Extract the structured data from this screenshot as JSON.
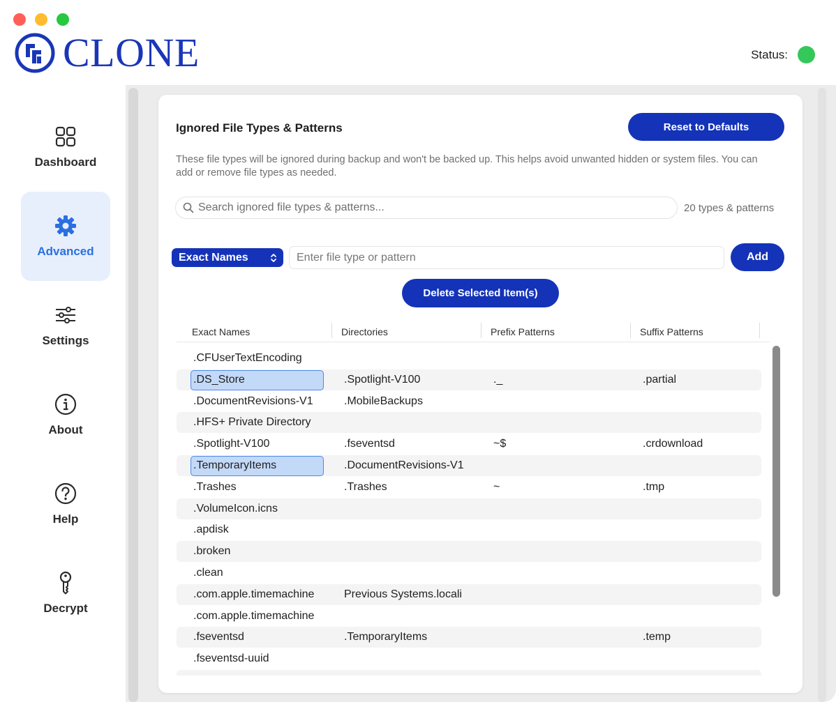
{
  "window": {
    "title": "CLONE"
  },
  "header": {
    "logo_text": "CLONE",
    "status_label": "Status:",
    "status_color": "#34c759"
  },
  "sidebar": {
    "items": [
      {
        "label": "Dashboard",
        "icon": "grid-icon"
      },
      {
        "label": "Advanced",
        "icon": "gear-icon",
        "active": true
      },
      {
        "label": "Settings",
        "icon": "sliders-icon"
      },
      {
        "label": "About",
        "icon": "info-icon"
      },
      {
        "label": "Help",
        "icon": "question-icon"
      },
      {
        "label": "Decrypt",
        "icon": "key-icon"
      }
    ]
  },
  "main": {
    "title": "Ignored File Types & Patterns",
    "reset_label": "Reset to Defaults",
    "description": "These file types will be ignored during backup and won't be backed up. This helps avoid unwanted hidden or system files. You can add or remove file types as needed.",
    "search_placeholder": "Search ignored file types & patterns...",
    "count_label": "20 types & patterns",
    "type_select_value": "Exact Names",
    "pattern_placeholder": "Enter file type or pattern",
    "add_label": "Add",
    "delete_label": "Delete Selected Item(s)",
    "columns": [
      "Exact Names",
      "Directories",
      "Prefix Patterns",
      "Suffix Patterns"
    ],
    "rows": [
      [
        ".CFUserTextEncoding",
        "",
        "",
        ""
      ],
      [
        ".DS_Store",
        ".Spotlight-V100",
        "._",
        ".partial"
      ],
      [
        ".DocumentRevisions-V1",
        ".MobileBackups",
        "",
        ""
      ],
      [
        ".HFS+ Private Directory",
        "",
        "",
        ""
      ],
      [
        ".Spotlight-V100",
        ".fseventsd",
        "~$",
        ".crdownload"
      ],
      [
        ".TemporaryItems",
        ".DocumentRevisions-V1",
        "",
        ""
      ],
      [
        ".Trashes",
        ".Trashes",
        "~",
        ".tmp"
      ],
      [
        ".VolumeIcon.icns",
        "",
        "",
        ""
      ],
      [
        ".apdisk",
        "",
        "",
        ""
      ],
      [
        ".broken",
        "",
        "",
        ""
      ],
      [
        ".clean",
        "",
        "",
        ""
      ],
      [
        ".com.apple.timemachine",
        "Previous Systems.locali",
        "",
        ""
      ],
      [
        ".com.apple.timemachine",
        "",
        "",
        ""
      ],
      [
        ".fseventsd",
        ".TemporaryItems",
        "",
        ".temp"
      ],
      [
        ".fseventsd-uuid",
        "",
        "",
        ""
      ],
      [
        "",
        "",
        "",
        ""
      ]
    ],
    "selected_rows": [
      1,
      5
    ]
  }
}
